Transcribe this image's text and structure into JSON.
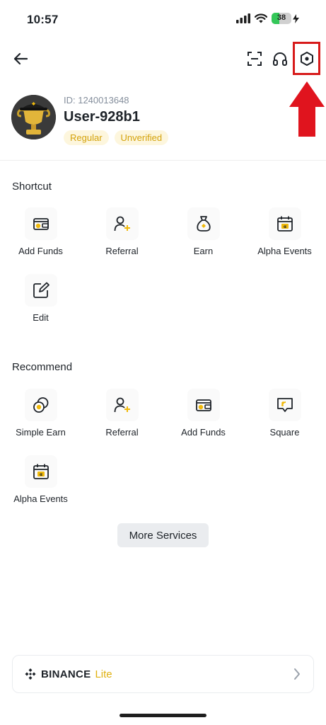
{
  "status": {
    "time": "10:57",
    "battery": "38",
    "battery_level": 0.38
  },
  "header": {
    "back_icon": "arrow-left-icon",
    "icons": [
      "scan-icon",
      "headset-icon",
      "settings-hex-icon"
    ]
  },
  "profile": {
    "id_text": "ID: 1240013648",
    "username": "User-928b1",
    "badges": [
      "Regular",
      "Unverified"
    ]
  },
  "shortcut": {
    "title": "Shortcut",
    "items": [
      {
        "label": "Add Funds",
        "icon": "wallet-icon"
      },
      {
        "label": "Referral",
        "icon": "user-plus-icon"
      },
      {
        "label": "Earn",
        "icon": "money-bag-icon"
      },
      {
        "label": "Alpha Events",
        "icon": "calendar-icon"
      },
      {
        "label": "Edit",
        "icon": "edit-icon"
      }
    ]
  },
  "recommend": {
    "title": "Recommend",
    "items": [
      {
        "label": "Simple Earn",
        "icon": "coins-icon"
      },
      {
        "label": "Referral",
        "icon": "user-plus-icon"
      },
      {
        "label": "Add Funds",
        "icon": "wallet-icon"
      },
      {
        "label": "Square",
        "icon": "chat-square-icon"
      },
      {
        "label": "Alpha Events",
        "icon": "calendar-icon"
      }
    ]
  },
  "more_services": "More Services",
  "lite_card": {
    "brand": "BINANCE",
    "mode": "Lite"
  },
  "colors": {
    "accent": "#F0B90B",
    "highlight": "#D71A1A",
    "text": "#1E2329"
  }
}
